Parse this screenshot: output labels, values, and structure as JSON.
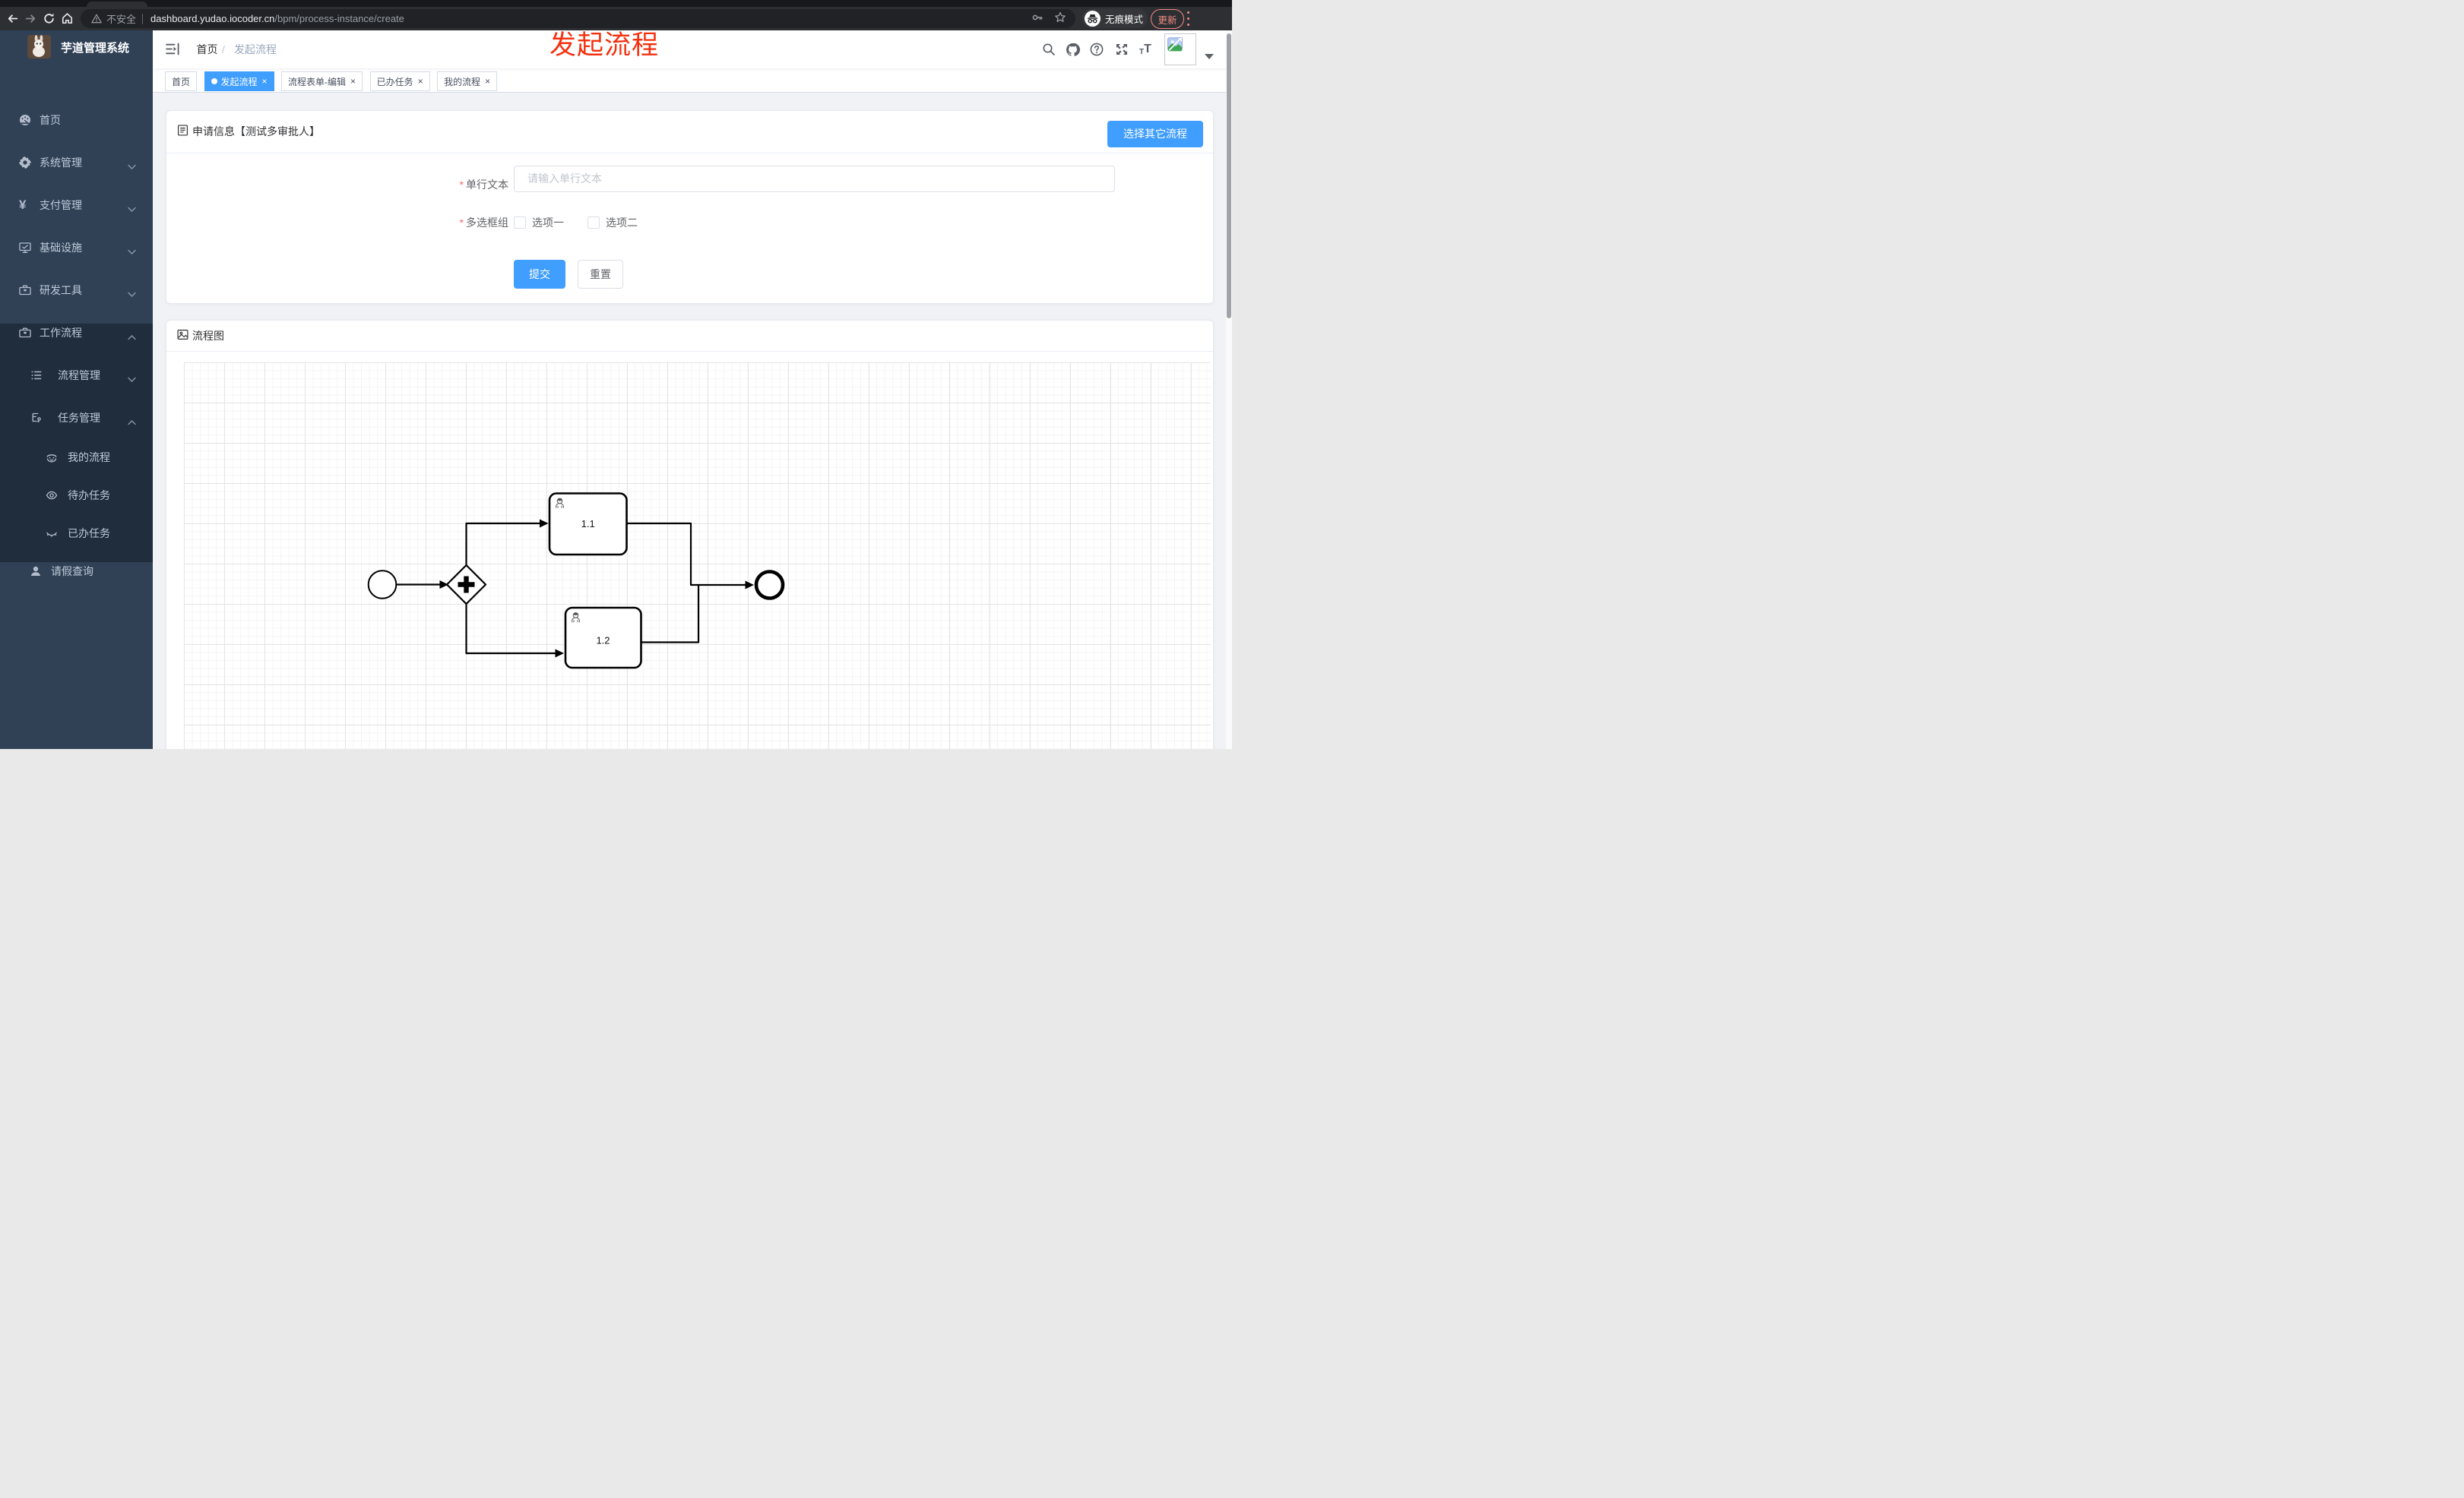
{
  "annotation": {
    "text": "发起流程",
    "color": "#f4300f"
  },
  "browser": {
    "security_label": "不安全",
    "url_host": "dashboard.yudao.iocoder.cn",
    "url_path": "/bpm/process-instance/create",
    "incognito_label": "无痕模式",
    "update_label": "更新"
  },
  "sidebar": {
    "title": "芋道管理系统",
    "items": [
      {
        "label": "首页"
      },
      {
        "label": "系统管理"
      },
      {
        "label": "支付管理"
      },
      {
        "label": "基础设施"
      },
      {
        "label": "研发工具"
      },
      {
        "label": "工作流程"
      },
      {
        "label": "流程管理"
      },
      {
        "label": "任务管理"
      },
      {
        "label": "我的流程"
      },
      {
        "label": "待办任务"
      },
      {
        "label": "已办任务"
      },
      {
        "label": "请假查询"
      }
    ]
  },
  "header": {
    "breadcrumb": {
      "home": "首页",
      "sep": "/",
      "current": "发起流程"
    }
  },
  "tags": {
    "close_glyph": "×",
    "items": [
      {
        "label": "首页",
        "active": false,
        "closable": false
      },
      {
        "label": "发起流程",
        "active": true,
        "closable": true
      },
      {
        "label": "流程表单-编辑",
        "active": false,
        "closable": true
      },
      {
        "label": "已办任务",
        "active": false,
        "closable": true
      },
      {
        "label": "我的流程",
        "active": false,
        "closable": true
      }
    ]
  },
  "form_card": {
    "title": "申请信息【测试多审批人】",
    "choose_other_button": "选择其它流程",
    "required_mark": "*",
    "single_line_label": "单行文本",
    "single_line_placeholder": "请输入单行文本",
    "single_line_value": "",
    "checkbox_group_label": "多选框组",
    "checkbox_options": [
      "选项一",
      "选项二"
    ],
    "submit_label": "提交",
    "reset_label": "重置",
    "accent_color": "#409eff"
  },
  "diagram_card": {
    "title": "流程图",
    "nodes": [
      {
        "id": "start",
        "type": "start-event",
        "label": ""
      },
      {
        "id": "gateway",
        "type": "parallel-gateway",
        "label": ""
      },
      {
        "id": "task1",
        "type": "user-task",
        "label": "1.1"
      },
      {
        "id": "task2",
        "type": "user-task",
        "label": "1.2"
      },
      {
        "id": "end",
        "type": "end-event",
        "label": ""
      }
    ],
    "flows": [
      {
        "from": "start",
        "to": "gateway"
      },
      {
        "from": "gateway",
        "to": "task1"
      },
      {
        "from": "gateway",
        "to": "task2"
      },
      {
        "from": "task1",
        "to": "end"
      },
      {
        "from": "task2",
        "to": "end"
      }
    ]
  }
}
